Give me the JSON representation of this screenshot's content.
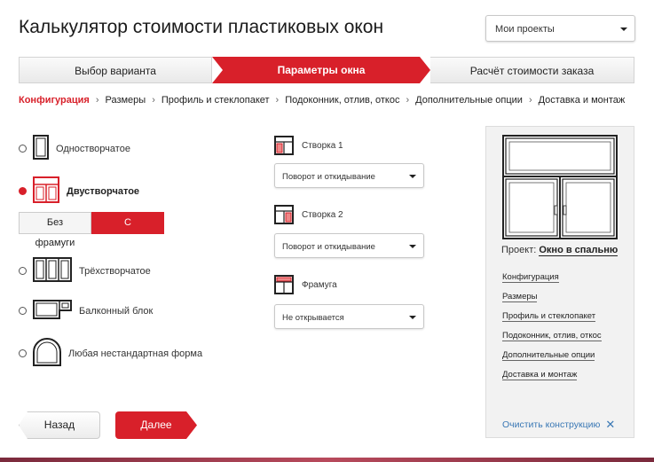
{
  "header": {
    "title": "Калькулятор стоимости пластиковых окон",
    "projects_select": "Мои проекты"
  },
  "steps": [
    "Выбор варианта",
    "Параметры окна",
    "Расчёт стоимости заказа"
  ],
  "breadcrumbs": [
    "Конфигурация",
    "Размеры",
    "Профиль и стеклопакет",
    "Подоконник, отлив, откос",
    "Дополнительные опции",
    "Доставка и монтаж"
  ],
  "window_types": [
    {
      "label": "Одностворчатое",
      "selected": false
    },
    {
      "label": "Двустворчатое",
      "selected": true
    },
    {
      "label": "Трёхстворчатое",
      "selected": false
    },
    {
      "label": "Балконный блок",
      "selected": false
    },
    {
      "label": "Любая нестандартная форма",
      "selected": false
    }
  ],
  "frame_toggle": {
    "without": "Без фрамуги",
    "with": "С фрамугой"
  },
  "sashes": [
    {
      "label": "Створка 1",
      "value": "Поворот и откидывание"
    },
    {
      "label": "Створка 2",
      "value": "Поворот и откидывание"
    },
    {
      "label": "Фрамуга",
      "value": "Не открывается"
    }
  ],
  "project": {
    "prefix": "Проект:",
    "name": "Окно в спальню",
    "links": [
      "Конфигурация",
      "Размеры",
      "Профиль и стеклопакет",
      "Подоконник, отлив, откос",
      "Дополнительные опции",
      "Доставка и монтаж"
    ],
    "clear": "Очистить конструкцию"
  },
  "nav": {
    "back": "Назад",
    "next": "Далее"
  },
  "colors": {
    "accent": "#d8202a",
    "link": "#3a78b5"
  }
}
